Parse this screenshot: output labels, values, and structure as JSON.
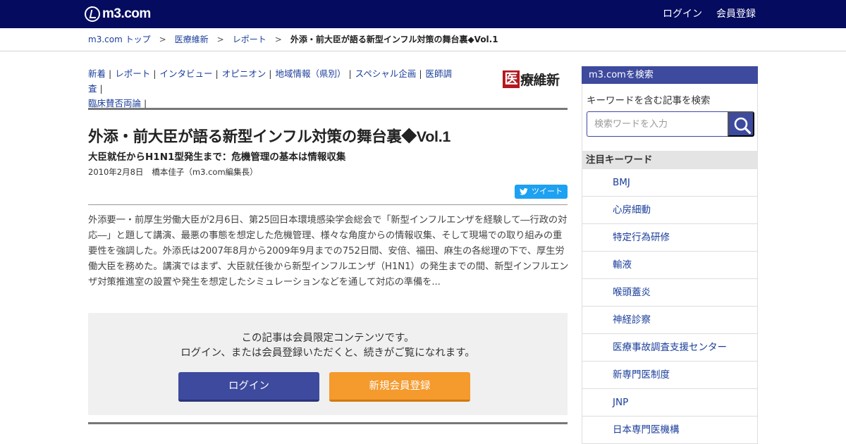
{
  "header": {
    "logo_text": "m3.com",
    "login_label": "ログイン",
    "register_label": "会員登録"
  },
  "breadcrumb": {
    "items": [
      "m3.com トップ",
      "医療維新",
      "レポート"
    ],
    "separator": ">",
    "current": "外添・前大臣が語る新型インフル対策の舞台裏◆Vol.1"
  },
  "category_nav": {
    "items": [
      "新着",
      "レポート",
      "インタビュー",
      "オピニオン",
      "地域情報（県別）",
      "スペシャル企画",
      "医師調査",
      "臨床賛否両論"
    ],
    "separator": "|"
  },
  "brand": {
    "box_char": "医",
    "rest": "療維新"
  },
  "article": {
    "title": "外添・前大臣が語る新型インフル対策の舞台裏◆Vol.1",
    "subtitle": "大臣就任からH1N1型発生まで：危機管理の基本は情報収集",
    "date": "2010年2月8日",
    "author": "橋本佳子（m3.com編集長）",
    "tweet_label": "ツイート",
    "body": "外添要一・前厚生労働大臣が2月6日、第25回日本環境感染学会総会で「新型インフルエンザを経験して―行政の対応―」と題して講演、最悪の事態を想定した危機管理、様々な角度からの情報収集、そして現場での取り組みの重要性を強調した。外添氏は2007年8月から2009年9月までの752日間、安倍、福田、麻生の各総理の下で、厚生労働大臣を務めた。講演ではまず、大臣就任後から新型インフルエンザ（H1N1）の発生までの間、新型インフルエンザ対策推進室の設置や発生を想定したシミュレーションなどを通して対応の準備を..."
  },
  "member_box": {
    "line1": "この記事は会員限定コンテンツです。",
    "line2": "ログイン、または会員登録いただくと、続きがご覧になれます。",
    "login_button": "ログイン",
    "register_button": "新規会員登録"
  },
  "sidebar": {
    "search_heading": "m3.comを検索",
    "search_label": "キーワードを含む記事を検索",
    "search_placeholder": "検索ワードを入力",
    "search_icon": "search-icon",
    "keywords_heading": "注目キーワード",
    "keywords": [
      "BMJ",
      "心房細動",
      "特定行為研修",
      "輸液",
      "喉頭蓋炎",
      "神経診察",
      "医療事故調査支援センター",
      "新専門医制度",
      "JNP",
      "日本専門医機構"
    ]
  },
  "colors": {
    "header_bg": "#050b5e",
    "link": "#1a3e9a",
    "sidebar_accent": "#3d4a9e",
    "register_orange": "#f59a2d",
    "twitter_blue": "#1da1f2",
    "brand_red": "#b3181f"
  }
}
